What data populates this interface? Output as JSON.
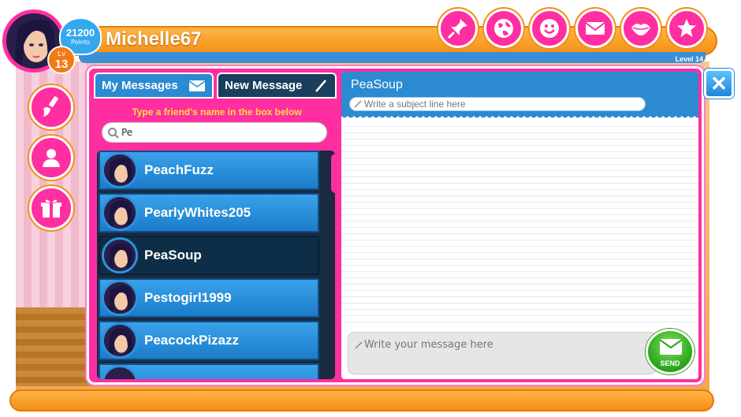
{
  "header": {
    "username": "Michelle67",
    "points_value": "21200",
    "points_label": "Points",
    "level_prefix": "Lv",
    "level_number": "13",
    "next_level_label": "Level 14"
  },
  "top_icons": [
    "pushpin-icon",
    "globe-icon",
    "smiley-icon",
    "envelope-icon",
    "lips-icon",
    "star-icon"
  ],
  "side_icons": [
    "paintbrush-icon",
    "profile-icon",
    "gift-icon"
  ],
  "messenger": {
    "tab_my_messages": "My Messages",
    "tab_new_message": "New Message",
    "hint": "Type a friend's name in the box below",
    "search_value": "Pe",
    "friends": [
      {
        "name": "PeachFuzz",
        "selected": false
      },
      {
        "name": "PearlyWhites205",
        "selected": false
      },
      {
        "name": "PeaSoup",
        "selected": true
      },
      {
        "name": "Pestogirl1999",
        "selected": false
      },
      {
        "name": "PeacockPizazz",
        "selected": false
      }
    ],
    "recipient": "PeaSoup",
    "subject_placeholder": "Write a subject line here",
    "message_placeholder": "Write your message here",
    "send_label": "SEND",
    "close_label": "✕"
  },
  "colors": {
    "pink": "#ff2ea1",
    "orange": "#f58f14",
    "blue": "#2c8ad1",
    "send_green": "#2aa21a"
  }
}
